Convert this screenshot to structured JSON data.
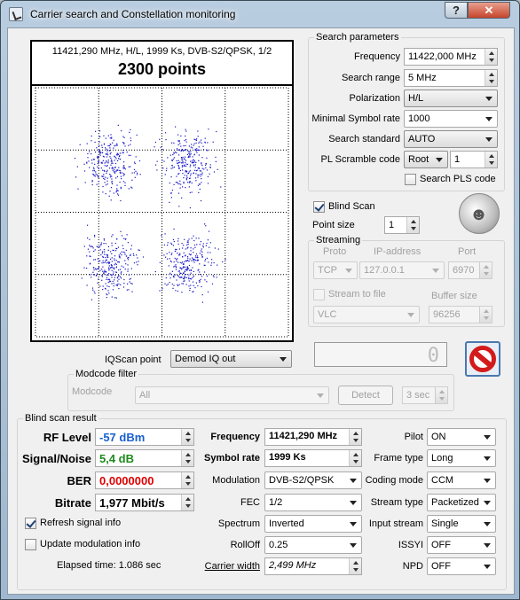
{
  "window": {
    "title": "Carrier search and Constellation monitoring",
    "help_label": "?",
    "close_label": "✕"
  },
  "plot": {
    "info": "11421,290 MHz, H/L, 1999 Ks, DVB-S2/QPSK, 1/2",
    "points_label": "2300 points",
    "dot_color": "#1515c8"
  },
  "search": {
    "group_title": "Search parameters",
    "frequency_label": "Frequency",
    "frequency_value": "11422,000 MHz",
    "range_label": "Search range",
    "range_value": "5 MHz",
    "polarization_label": "Polarization",
    "polarization_value": "H/L",
    "min_sr_label": "Minimal Symbol rate",
    "min_sr_value": "1000",
    "standard_label": "Search standard",
    "standard_value": "AUTO",
    "pls_label": "PL Scramble code",
    "pls_mode": "Root",
    "pls_value": "1",
    "search_pls_label": "Search PLS code",
    "blind_scan_label": "Blind Scan",
    "point_size_label": "Point size",
    "point_size_value": "1"
  },
  "streaming": {
    "group_title": "Streaming",
    "proto_label": "Proto",
    "ip_label": "IP-address",
    "port_label": "Port",
    "proto_value": "TCP",
    "ip_value": "127.0.0.1",
    "port_value": "6970",
    "stream_to_file_label": "Stream to file",
    "buffer_label": "Buffer size",
    "player_value": "VLC",
    "buffer_value": "96256"
  },
  "counter_value": "0",
  "iqscan": {
    "label": "IQScan point",
    "value": "Demod IQ out"
  },
  "modcode": {
    "group_title": "Modcode filter",
    "label": "Modcode",
    "value": "All",
    "detect_label": "Detect",
    "time_value": "3 sec"
  },
  "result": {
    "group_title": "Blind scan result",
    "rf_level_label": "RF Level",
    "rf_level_value": "-57 dBm",
    "snr_label": "Signal/Noise",
    "snr_value": "5,4 dB",
    "ber_label": "BER",
    "ber_value": "0,0000000",
    "bitrate_label": "Bitrate",
    "bitrate_value": "1,977 Mbit/s",
    "refresh_label": "Refresh signal info",
    "update_label": "Update modulation info",
    "elapsed_label": "Elapsed time: 1.086 sec",
    "frequency_label": "Frequency",
    "frequency_value": "11421,290 MHz",
    "symbol_rate_label": "Symbol rate",
    "symbol_rate_value": "1999 Ks",
    "modulation_label": "Modulation",
    "modulation_value": "DVB-S2/QPSK",
    "fec_label": "FEC",
    "fec_value": "1/2",
    "spectrum_label": "Spectrum",
    "spectrum_value": "Inverted",
    "rolloff_label": "RollOff",
    "rolloff_value": "0.25",
    "carrier_width_label": "Carrier width",
    "carrier_width_value": "2,499 MHz",
    "pilot_label": "Pilot",
    "pilot_value": "ON",
    "frame_type_label": "Frame type",
    "frame_type_value": "Long",
    "coding_mode_label": "Coding mode",
    "coding_mode_value": "CCM",
    "stream_type_label": "Stream type",
    "stream_type_value": "Packetized",
    "input_stream_label": "Input stream",
    "input_stream_value": "Single",
    "issyi_label": "ISSYI",
    "issyi_value": "OFF",
    "npd_label": "NPD",
    "npd_value": "OFF",
    "rf_color": "#1a5fd0",
    "snr_color": "#1d8a1d",
    "ber_color": "#e00000"
  }
}
